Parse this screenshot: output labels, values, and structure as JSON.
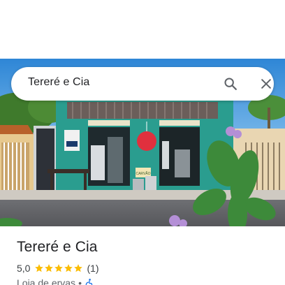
{
  "search": {
    "query": "Tereré e Cia"
  },
  "place": {
    "name": "Tereré e Cia",
    "rating": "5,0",
    "stars": 5,
    "review_count": "(1)",
    "category": "Loja de ervas",
    "separator": "•"
  },
  "photo": {
    "icons": [
      "store-photo"
    ],
    "sign_text": "CARVÃO"
  },
  "colors": {
    "star": "#fbbc04",
    "text": "#202124",
    "secondary_text": "#5f6368",
    "accessibility_blue": "#1a73e8"
  }
}
